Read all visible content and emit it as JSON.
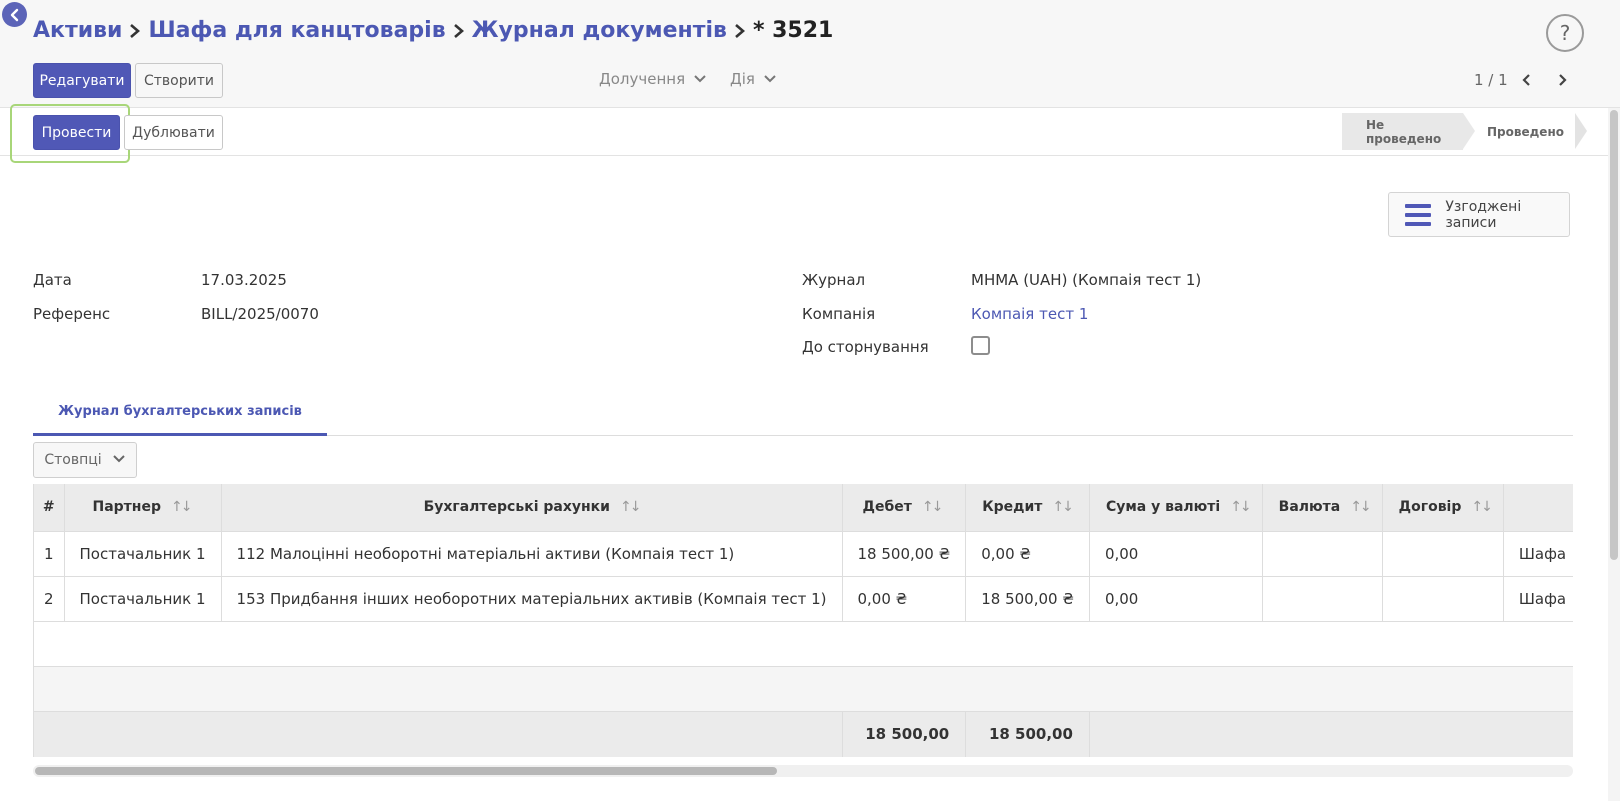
{
  "breadcrumb": {
    "items": [
      "Активи",
      "Шафа для канцтоварів",
      "Журнал документів"
    ],
    "current": "* 3521"
  },
  "control_panel": {
    "edit_label": "Редагувати",
    "create_label": "Створити",
    "attach_label": "Долучення",
    "action_label": "Дія",
    "pager": "1 / 1",
    "help_label": "?"
  },
  "statusbar": {
    "post_label": "Провести",
    "duplicate_label": "Дублювати",
    "stages": [
      "Не проведено",
      "Проведено"
    ]
  },
  "smart_button": {
    "label": "Узгоджені записи"
  },
  "form": {
    "date_label": "Дата",
    "date_value": "17.03.2025",
    "ref_label": "Референс",
    "ref_value": "BILL/2025/0070",
    "journal_label": "Журнал",
    "journal_value": "МНМА (UAH) (Компаія тест 1)",
    "company_label": "Компанія",
    "company_value": "Компаія тест 1",
    "reverse_label": "До сторнування",
    "reverse_checked": false
  },
  "tab": {
    "label": "Журнал бухгалтерських записів"
  },
  "columns_btn": {
    "label": "Стовпці"
  },
  "table": {
    "headers": [
      "#",
      "Партнер",
      "Бухгалтерські рахунки",
      "Дебет",
      "Кредит",
      "Сума у валюті",
      "Валюта",
      "Договір",
      ""
    ],
    "rows": [
      [
        "1",
        "Постачальник 1",
        "112 Малоцінні необоротні матеріальні активи (Компаія тест 1)",
        "18 500,00 ₴",
        "0,00 ₴",
        "0,00",
        "",
        "",
        "Шафа"
      ],
      [
        "2",
        "Постачальник 1",
        "153 Придбання інших необоротних матеріальних активів (Компаія тест 1)",
        "0,00 ₴",
        "18 500,00 ₴",
        "0,00",
        "",
        "",
        "Шафа"
      ]
    ],
    "totals": {
      "debit": "18 500,00",
      "credit": "18 500,00"
    }
  },
  "colors": {
    "primary": "#5058b6",
    "link": "#4c58b3",
    "highlight": "#a8d679"
  }
}
